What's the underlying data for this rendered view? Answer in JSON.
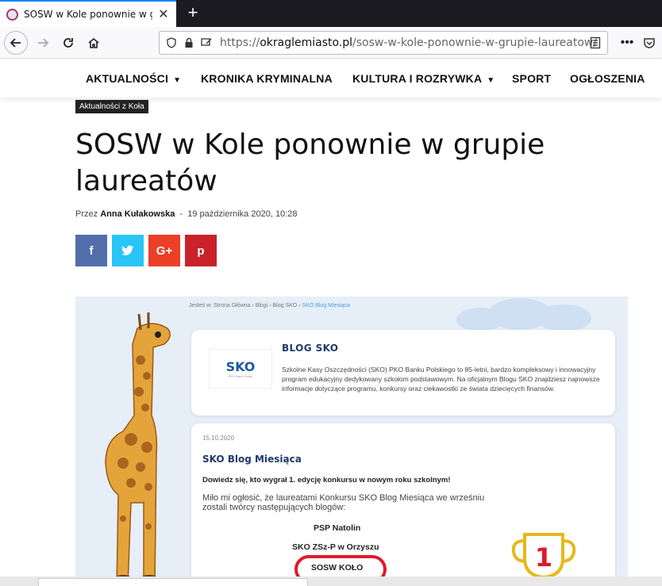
{
  "browser": {
    "tab_title": "SOSW w Kole ponownie w grupie laureatów",
    "url_protocol": "https://",
    "url_host": "okraglemiasto.pl",
    "url_path": "/sosw-w-kole-ponownie-w-grupie-laureatow/"
  },
  "nav": {
    "items": [
      "AKTUALNOŚCI",
      "KRONIKA KRYMINALNA",
      "KULTURA I ROZRYWKA",
      "SPORT",
      "OGŁOSZENIA"
    ]
  },
  "article": {
    "category": "Aktualności z Koła",
    "title": "SOSW w Kole ponownie w grupie laureatów",
    "by_label": "Przez",
    "author": "Anna Kułakowska",
    "separator": "-",
    "date": "19 października 2020, 10:28"
  },
  "share": {
    "facebook": "f",
    "twitter": "t",
    "googleplus": "G+",
    "pinterest": "p"
  },
  "image": {
    "crumbs_prefix": "Jesteś w:",
    "crumb1": "Strona Główna",
    "crumb2": "Blogi",
    "crumb3": "Blog SKO",
    "crumb_current": "SKO Blog Miesiąca",
    "sko_logo": "SKO",
    "sko_logo_sub": "PKO Bank Polski",
    "blog_title": "BLOG SKO",
    "blog_desc": "Szkolne Kasy Oszczędności (SKO) PKO Banku Polskiego to 85-letni, bardzo kompleksowy i innowacyjny program edukacyjny dedykowany szkołom podstawowym. Na oficjalnym Blogu SKO znajdziesz najnowsze informacje dotyczące programu, konkursy oraz ciekawostki ze świata dziecięcych finansów.",
    "post_date": "15.10.2020",
    "post_title": "SKO Blog Miesiąca",
    "post_lead": "Dowiedz się, kto wygrał 1. edycję konkursu w nowym roku szkolnym!",
    "post_para": "Miło mi ogłosić, że laureatami Konkursu SKO Blog Miesiąca we wrześniu zostali twórcy następujących blogów:",
    "winners": [
      "PSP Natolin",
      "SKO ZSz-P w Orzyszu",
      "SOSW KOŁO"
    ],
    "trophy_number": "1"
  },
  "colors": {
    "facebook": "#516eab",
    "twitter": "#29c5f6",
    "googleplus": "#eb4026",
    "pinterest": "#ca212a",
    "accent": "#0a84ff"
  }
}
